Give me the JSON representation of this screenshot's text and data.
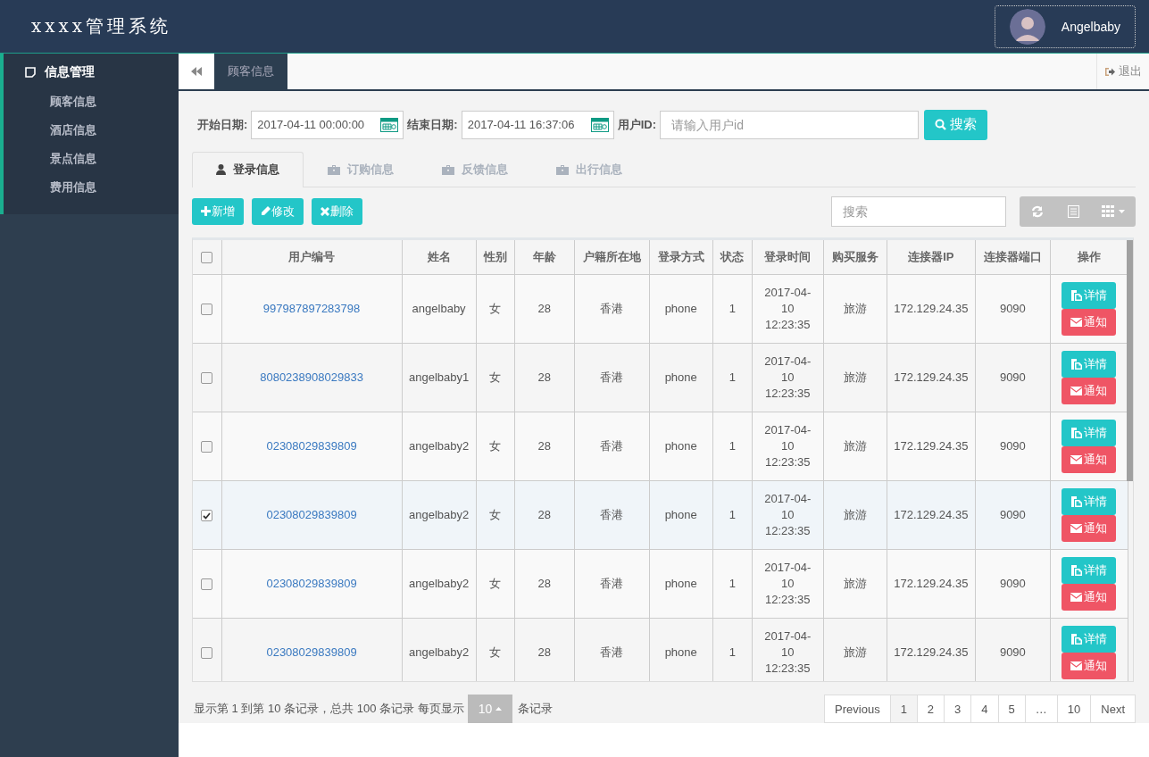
{
  "header": {
    "title": "xxxx管理系统",
    "user": "Angelbaby"
  },
  "sidebar": {
    "group": "信息管理",
    "items": [
      "顾客信息",
      "酒店信息",
      "景点信息",
      "费用信息"
    ]
  },
  "page_tabs": [
    {
      "label": "顾客信息",
      "selected": true
    }
  ],
  "logout": "退出",
  "filters": [
    {
      "kind": "date",
      "label": "开始日期:",
      "value": "2017-04-11 00:00:00"
    },
    {
      "kind": "date",
      "label": "结束日期:",
      "value": "2017-04-11 16:37:06"
    },
    {
      "kind": "text",
      "label": "用户ID:",
      "placeholder": "请输入用户id"
    }
  ],
  "search_button": "搜索",
  "info_tabs": [
    {
      "label": "登录信息",
      "kind": "user",
      "selected": true
    },
    {
      "label": "订购信息",
      "kind": "case",
      "selected": false
    },
    {
      "label": "反馈信息",
      "kind": "case",
      "selected": false
    },
    {
      "label": "出行信息",
      "kind": "case",
      "selected": false
    }
  ],
  "actions": [
    {
      "kind": "add",
      "label": "新增"
    },
    {
      "kind": "edit",
      "label": "修改"
    },
    {
      "kind": "delete",
      "label": "删除"
    }
  ],
  "table_search": {
    "placeholder": "搜索"
  },
  "table": {
    "select_all_checked": false,
    "columns": [
      "用户编号",
      "姓名",
      "性别",
      "年龄",
      "户籍所在地",
      "登录方式",
      "状态",
      "登录时间",
      "购买服务",
      "连接器IP",
      "连接器端口",
      "操作"
    ],
    "rows": [
      {
        "checked": false,
        "cells": [
          "997987897283798",
          "angelbaby",
          "女",
          "28",
          "香港",
          "phone",
          "1",
          "2017-04-10 12:23:35",
          "旅游",
          "172.129.24.35",
          "9090"
        ],
        "buttons": [
          "详情",
          "通知"
        ]
      },
      {
        "checked": false,
        "cells": [
          "8080238908029833",
          "angelbaby1",
          "女",
          "28",
          "香港",
          "phone",
          "1",
          "2017-04-10 12:23:35",
          "旅游",
          "172.129.24.35",
          "9090"
        ],
        "buttons": [
          "详情",
          "通知"
        ]
      },
      {
        "checked": false,
        "cells": [
          "02308029839809",
          "angelbaby2",
          "女",
          "28",
          "香港",
          "phone",
          "1",
          "2017-04-10 12:23:35",
          "旅游",
          "172.129.24.35",
          "9090"
        ],
        "buttons": [
          "详情",
          "通知"
        ]
      },
      {
        "checked": true,
        "cells": [
          "02308029839809",
          "angelbaby2",
          "女",
          "28",
          "香港",
          "phone",
          "1",
          "2017-04-10 12:23:35",
          "旅游",
          "172.129.24.35",
          "9090"
        ],
        "buttons": [
          "详情",
          "通知"
        ]
      },
      {
        "checked": false,
        "cells": [
          "02308029839809",
          "angelbaby2",
          "女",
          "28",
          "香港",
          "phone",
          "1",
          "2017-04-10 12:23:35",
          "旅游",
          "172.129.24.35",
          "9090"
        ],
        "buttons": [
          "详情",
          "通知"
        ]
      },
      {
        "checked": false,
        "cells": [
          "02308029839809",
          "angelbaby2",
          "女",
          "28",
          "香港",
          "phone",
          "1",
          "2017-04-10 12:23:35",
          "旅游",
          "172.129.24.35",
          "9090"
        ],
        "buttons": [
          "详情",
          "通知"
        ]
      }
    ]
  },
  "pagination": {
    "summary": "显示第 1 到第 10 条记录，总共 100 条记录 每页显示",
    "page_size": "10",
    "suffix": "条记录",
    "pages": [
      {
        "label": "Previous",
        "selected": false
      },
      {
        "label": "1",
        "selected": true
      },
      {
        "label": "2",
        "selected": false
      },
      {
        "label": "3",
        "selected": false
      },
      {
        "label": "4",
        "selected": false
      },
      {
        "label": "5",
        "selected": false
      },
      {
        "label": "…",
        "selected": false
      },
      {
        "label": "10",
        "selected": false
      },
      {
        "label": "Next",
        "selected": false
      }
    ]
  }
}
